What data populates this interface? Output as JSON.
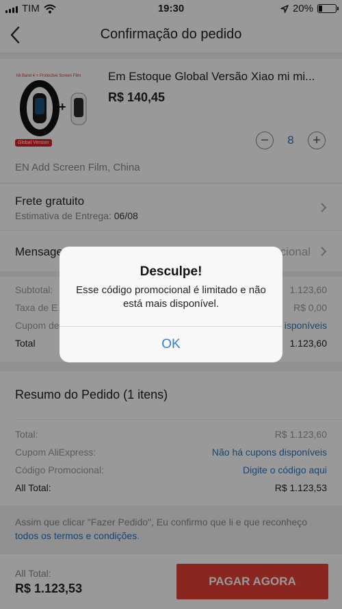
{
  "status_bar": {
    "carrier": "TIM",
    "time": "19:30",
    "battery_percent": "20%",
    "battery_level": 0.2
  },
  "header": {
    "title": "Confirmação do pedido"
  },
  "product": {
    "image_banner": "Mi Band 4 + Protective Screen Film",
    "image_tag": "Global Version",
    "title": "Em Estoque Global Versão Xiao mi mi...",
    "price": "R$ 140,45",
    "quantity": "8",
    "decrement_symbol": "−",
    "increment_symbol": "+",
    "variant": "EN Add Screen Film, China"
  },
  "shipping": {
    "label": "Frete gratuito",
    "estimate_label": "Estimativa de Entrega:",
    "estimate_date": "06/08"
  },
  "message": {
    "label": "Mensage",
    "right_text": "cional"
  },
  "order_breakdown": {
    "rows": [
      {
        "label": "Subtotal:",
        "value": "1.123,60"
      },
      {
        "label": "Taxa de E",
        "value": "R$ 0,00"
      },
      {
        "label": "Cupom de",
        "value": "isponíveis"
      },
      {
        "label": "Total",
        "value": "1.123,60"
      }
    ]
  },
  "summary": {
    "title": "Resumo do Pedido (1 itens)",
    "rows": [
      {
        "label": "Total:",
        "value": "R$ 1.123,60"
      },
      {
        "label": "Cupom AliExpress:",
        "value": "Não há cupons disponíveis"
      },
      {
        "label": "Código Promocional:",
        "value": "Digite o código aqui"
      },
      {
        "label": "All Total:",
        "value": "R$ 1.123,53"
      }
    ]
  },
  "terms": {
    "text_before": "Assim que clicar \"Fazer Pedido\", Eu confirmo que li e que reconheço ",
    "link": "todos os termos e condições",
    "text_after": "."
  },
  "bottom": {
    "total_label": "All Total:",
    "total_value": "R$ 1.123,53",
    "pay_button": "PAGAR AGORA"
  },
  "alert": {
    "title": "Desculpe!",
    "message": "Esse código promocional é limitado e não está mais disponível.",
    "ok_button": "OK"
  },
  "colors": {
    "accent": "#2b74b8",
    "pay_button": "#e34034",
    "alert_button": "#2f7fd8"
  }
}
